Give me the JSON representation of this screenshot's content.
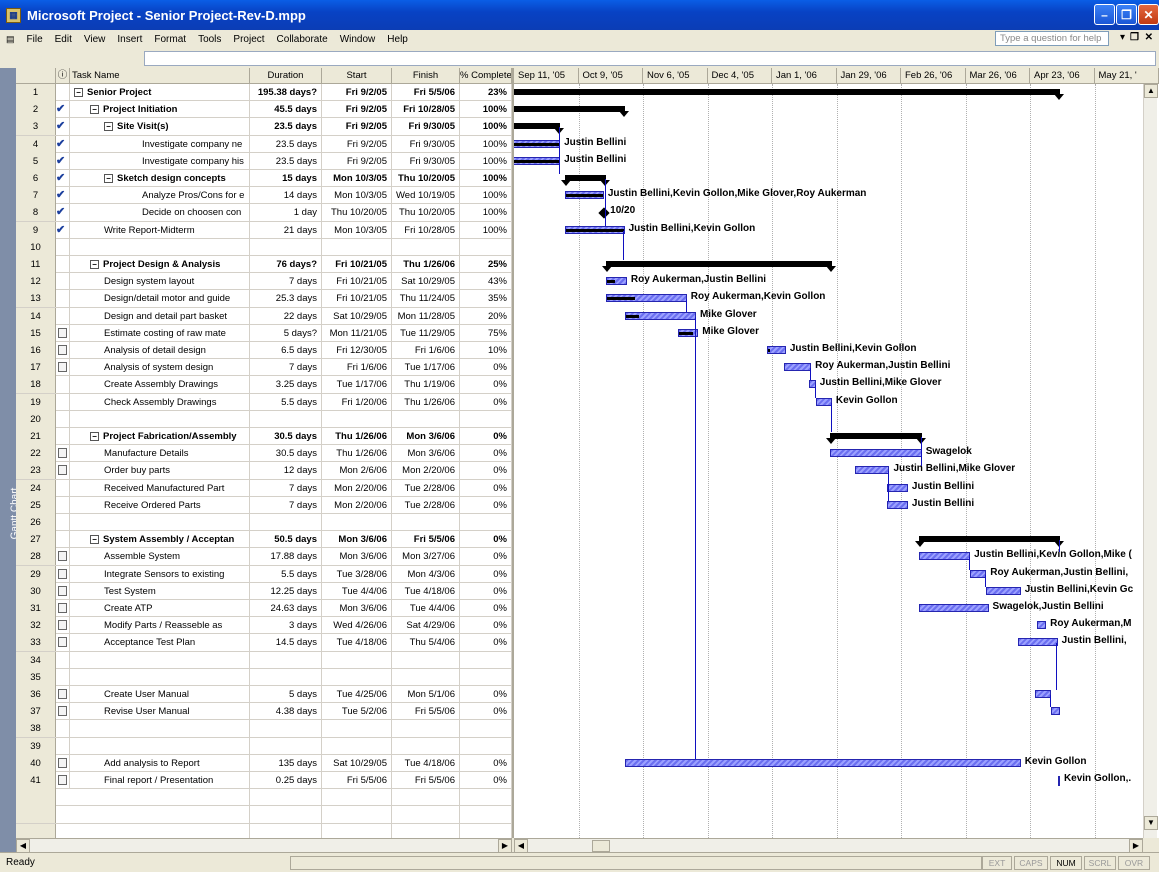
{
  "window": {
    "title": "Microsoft Project - Senior Project-Rev-D.mpp"
  },
  "menu": [
    "File",
    "Edit",
    "View",
    "Insert",
    "Format",
    "Tools",
    "Project",
    "Collaborate",
    "Window",
    "Help"
  ],
  "ask_placeholder": "Type a question for help",
  "view_bar_label": "Gantt Chart",
  "columns": {
    "name": "Task Name",
    "duration": "Duration",
    "start": "Start",
    "finish": "Finish",
    "pct": "% Complete"
  },
  "timescale": [
    "Sep 11, '05",
    "Oct 9, '05",
    "Nov 6, '05",
    "Dec 4, '05",
    "Jan 1, '06",
    "Jan 29, '06",
    "Feb 26, '06",
    "Mar 26, '06",
    "Apr 23, '06",
    "May 21, '"
  ],
  "tasks": [
    {
      "id": "1",
      "ind": "",
      "name": "Senior Project",
      "level": 0,
      "summary": true,
      "dur": "195.38 days?",
      "start": "Fri 9/2/05",
      "finish": "Fri 5/5/06",
      "pct": "23%"
    },
    {
      "id": "2",
      "ind": "check",
      "name": "Project Initiation",
      "level": 1,
      "summary": true,
      "dur": "45.5 days",
      "start": "Fri 9/2/05",
      "finish": "Fri 10/28/05",
      "pct": "100%"
    },
    {
      "id": "3",
      "ind": "check",
      "name": "Site Visit(s)",
      "level": 2,
      "summary": true,
      "dur": "23.5 days",
      "start": "Fri 9/2/05",
      "finish": "Fri 9/30/05",
      "pct": "100%"
    },
    {
      "id": "4",
      "ind": "check",
      "name": "Investigate company ne",
      "level": 3,
      "summary": false,
      "dur": "23.5 days",
      "start": "Fri 9/2/05",
      "finish": "Fri 9/30/05",
      "pct": "100%"
    },
    {
      "id": "5",
      "ind": "check",
      "name": "Investigate company his",
      "level": 3,
      "summary": false,
      "dur": "23.5 days",
      "start": "Fri 9/2/05",
      "finish": "Fri 9/30/05",
      "pct": "100%"
    },
    {
      "id": "6",
      "ind": "check",
      "name": "Sketch design concepts",
      "level": 2,
      "summary": true,
      "dur": "15 days",
      "start": "Mon 10/3/05",
      "finish": "Thu 10/20/05",
      "pct": "100%"
    },
    {
      "id": "7",
      "ind": "check",
      "name": "Analyze Pros/Cons for e",
      "level": 3,
      "summary": false,
      "dur": "14 days",
      "start": "Mon 10/3/05",
      "finish": "Wed 10/19/05",
      "pct": "100%"
    },
    {
      "id": "8",
      "ind": "check",
      "name": "Decide on choosen con",
      "level": 3,
      "summary": false,
      "dur": "1 day",
      "start": "Thu 10/20/05",
      "finish": "Thu 10/20/05",
      "pct": "100%"
    },
    {
      "id": "9",
      "ind": "check",
      "name": "Write Report-Midterm",
      "level": 2,
      "summary": false,
      "dur": "21 days",
      "start": "Mon 10/3/05",
      "finish": "Fri 10/28/05",
      "pct": "100%"
    },
    {
      "id": "10",
      "ind": "",
      "name": "",
      "level": 0,
      "summary": false,
      "dur": "",
      "start": "",
      "finish": "",
      "pct": ""
    },
    {
      "id": "11",
      "ind": "",
      "name": "Project Design & Analysis",
      "level": 1,
      "summary": true,
      "dur": "76 days?",
      "start": "Fri 10/21/05",
      "finish": "Thu 1/26/06",
      "pct": "25%"
    },
    {
      "id": "12",
      "ind": "",
      "name": "Design system layout",
      "level": 2,
      "summary": false,
      "dur": "7 days",
      "start": "Fri 10/21/05",
      "finish": "Sat 10/29/05",
      "pct": "43%"
    },
    {
      "id": "13",
      "ind": "",
      "name": "Design/detail motor and guide",
      "level": 2,
      "summary": false,
      "dur": "25.3 days",
      "start": "Fri 10/21/05",
      "finish": "Thu 11/24/05",
      "pct": "35%"
    },
    {
      "id": "14",
      "ind": "",
      "name": "Design and detail part basket",
      "level": 2,
      "summary": false,
      "dur": "22 days",
      "start": "Sat 10/29/05",
      "finish": "Mon 11/28/05",
      "pct": "20%"
    },
    {
      "id": "15",
      "ind": "note",
      "name": "Estimate costing of raw mate",
      "level": 2,
      "summary": false,
      "dur": "5 days?",
      "start": "Mon 11/21/05",
      "finish": "Tue 11/29/05",
      "pct": "75%"
    },
    {
      "id": "16",
      "ind": "note",
      "name": "Analysis of detail design",
      "level": 2,
      "summary": false,
      "dur": "6.5 days",
      "start": "Fri 12/30/05",
      "finish": "Fri 1/6/06",
      "pct": "10%"
    },
    {
      "id": "17",
      "ind": "note",
      "name": "Analysis of system design",
      "level": 2,
      "summary": false,
      "dur": "7 days",
      "start": "Fri 1/6/06",
      "finish": "Tue 1/17/06",
      "pct": "0%"
    },
    {
      "id": "18",
      "ind": "",
      "name": "Create Assembly Drawings",
      "level": 2,
      "summary": false,
      "dur": "3.25 days",
      "start": "Tue 1/17/06",
      "finish": "Thu 1/19/06",
      "pct": "0%"
    },
    {
      "id": "19",
      "ind": "",
      "name": "Check Assembly Drawings",
      "level": 2,
      "summary": false,
      "dur": "5.5 days",
      "start": "Fri 1/20/06",
      "finish": "Thu 1/26/06",
      "pct": "0%"
    },
    {
      "id": "20",
      "ind": "",
      "name": "",
      "level": 0,
      "summary": false,
      "dur": "",
      "start": "",
      "finish": "",
      "pct": ""
    },
    {
      "id": "21",
      "ind": "",
      "name": "Project Fabrication/Assembly",
      "level": 1,
      "summary": true,
      "dur": "30.5 days",
      "start": "Thu 1/26/06",
      "finish": "Mon 3/6/06",
      "pct": "0%"
    },
    {
      "id": "22",
      "ind": "note",
      "name": "Manufacture Details",
      "level": 2,
      "summary": false,
      "dur": "30.5 days",
      "start": "Thu 1/26/06",
      "finish": "Mon 3/6/06",
      "pct": "0%"
    },
    {
      "id": "23",
      "ind": "note",
      "name": "Order buy parts",
      "level": 2,
      "summary": false,
      "dur": "12 days",
      "start": "Mon 2/6/06",
      "finish": "Mon 2/20/06",
      "pct": "0%"
    },
    {
      "id": "24",
      "ind": "",
      "name": "Received Manufactured Part",
      "level": 2,
      "summary": false,
      "dur": "7 days",
      "start": "Mon 2/20/06",
      "finish": "Tue 2/28/06",
      "pct": "0%"
    },
    {
      "id": "25",
      "ind": "",
      "name": "Receive Ordered Parts",
      "level": 2,
      "summary": false,
      "dur": "7 days",
      "start": "Mon 2/20/06",
      "finish": "Tue 2/28/06",
      "pct": "0%"
    },
    {
      "id": "26",
      "ind": "",
      "name": "",
      "level": 0,
      "summary": false,
      "dur": "",
      "start": "",
      "finish": "",
      "pct": ""
    },
    {
      "id": "27",
      "ind": "",
      "name": "System Assembly / Acceptan",
      "level": 1,
      "summary": true,
      "dur": "50.5 days",
      "start": "Mon 3/6/06",
      "finish": "Fri 5/5/06",
      "pct": "0%"
    },
    {
      "id": "28",
      "ind": "note",
      "name": "Assemble System",
      "level": 2,
      "summary": false,
      "dur": "17.88 days",
      "start": "Mon 3/6/06",
      "finish": "Mon 3/27/06",
      "pct": "0%"
    },
    {
      "id": "29",
      "ind": "note",
      "name": "Integrate Sensors to existing",
      "level": 2,
      "summary": false,
      "dur": "5.5 days",
      "start": "Tue 3/28/06",
      "finish": "Mon 4/3/06",
      "pct": "0%"
    },
    {
      "id": "30",
      "ind": "note",
      "name": "Test System",
      "level": 2,
      "summary": false,
      "dur": "12.25 days",
      "start": "Tue 4/4/06",
      "finish": "Tue 4/18/06",
      "pct": "0%"
    },
    {
      "id": "31",
      "ind": "note",
      "name": "Create ATP",
      "level": 2,
      "summary": false,
      "dur": "24.63 days",
      "start": "Mon 3/6/06",
      "finish": "Tue 4/4/06",
      "pct": "0%"
    },
    {
      "id": "32",
      "ind": "note",
      "name": "Modify Parts / Reasseble as",
      "level": 2,
      "summary": false,
      "dur": "3 days",
      "start": "Wed 4/26/06",
      "finish": "Sat 4/29/06",
      "pct": "0%"
    },
    {
      "id": "33",
      "ind": "note",
      "name": "Acceptance Test Plan",
      "level": 2,
      "summary": false,
      "dur": "14.5 days",
      "start": "Tue 4/18/06",
      "finish": "Thu 5/4/06",
      "pct": "0%"
    },
    {
      "id": "34",
      "ind": "",
      "name": "",
      "level": 0,
      "summary": false,
      "dur": "",
      "start": "",
      "finish": "",
      "pct": ""
    },
    {
      "id": "35",
      "ind": "",
      "name": "",
      "level": 0,
      "summary": false,
      "dur": "",
      "start": "",
      "finish": "",
      "pct": ""
    },
    {
      "id": "36",
      "ind": "note",
      "name": "Create User Manual",
      "level": 2,
      "summary": false,
      "dur": "5 days",
      "start": "Tue 4/25/06",
      "finish": "Mon 5/1/06",
      "pct": "0%"
    },
    {
      "id": "37",
      "ind": "note",
      "name": "Revise User Manual",
      "level": 2,
      "summary": false,
      "dur": "4.38 days",
      "start": "Tue 5/2/06",
      "finish": "Fri 5/5/06",
      "pct": "0%"
    },
    {
      "id": "38",
      "ind": "",
      "name": "",
      "level": 0,
      "summary": false,
      "dur": "",
      "start": "",
      "finish": "",
      "pct": ""
    },
    {
      "id": "39",
      "ind": "",
      "name": "",
      "level": 0,
      "summary": false,
      "dur": "",
      "start": "",
      "finish": "",
      "pct": ""
    },
    {
      "id": "40",
      "ind": "note",
      "name": "Add analysis to Report",
      "level": 1,
      "summary": false,
      "dur": "135 days",
      "start": "Sat 10/29/05",
      "finish": "Tue 4/18/06",
      "pct": "0%"
    },
    {
      "id": "41",
      "ind": "note",
      "name": "Final report / Presentation",
      "level": 1,
      "summary": false,
      "dur": "0.25 days",
      "start": "Fri 5/5/06",
      "finish": "Fri 5/5/06",
      "pct": "0%"
    }
  ],
  "gantt_labels": [
    "Justin Bellini",
    "Justin Bellini",
    "Justin Bellini,Kevin Gollon,Mike Glover,Roy Aukerman",
    "10/20",
    "Justin Bellini,Kevin Gollon",
    "Roy Aukerman,Justin Bellini",
    "Roy Aukerman,Kevin Gollon",
    "Mike Glover",
    "Mike Glover",
    "Justin Bellini,Kevin Gollon",
    "Roy Aukerman,Justin Bellini",
    "Justin Bellini,Mike Glover",
    "Kevin Gollon",
    "Swagelok",
    "Justin Bellini,Mike Glover",
    "Justin Bellini",
    "Justin Bellini",
    "Justin Bellini,Kevin Gollon,Mike (",
    "Roy Aukerman,Justin Bellini,",
    "Justin Bellini,Kevin Gc",
    "Swagelok,Justin Bellini",
    "Roy Aukerman,M",
    "Justin Bellini,",
    "Kevin Gollon",
    "Kevin Gollon,."
  ],
  "status": {
    "ready": "Ready",
    "keys": [
      "EXT",
      "CAPS",
      "NUM",
      "SCRL",
      "OVR"
    ]
  }
}
